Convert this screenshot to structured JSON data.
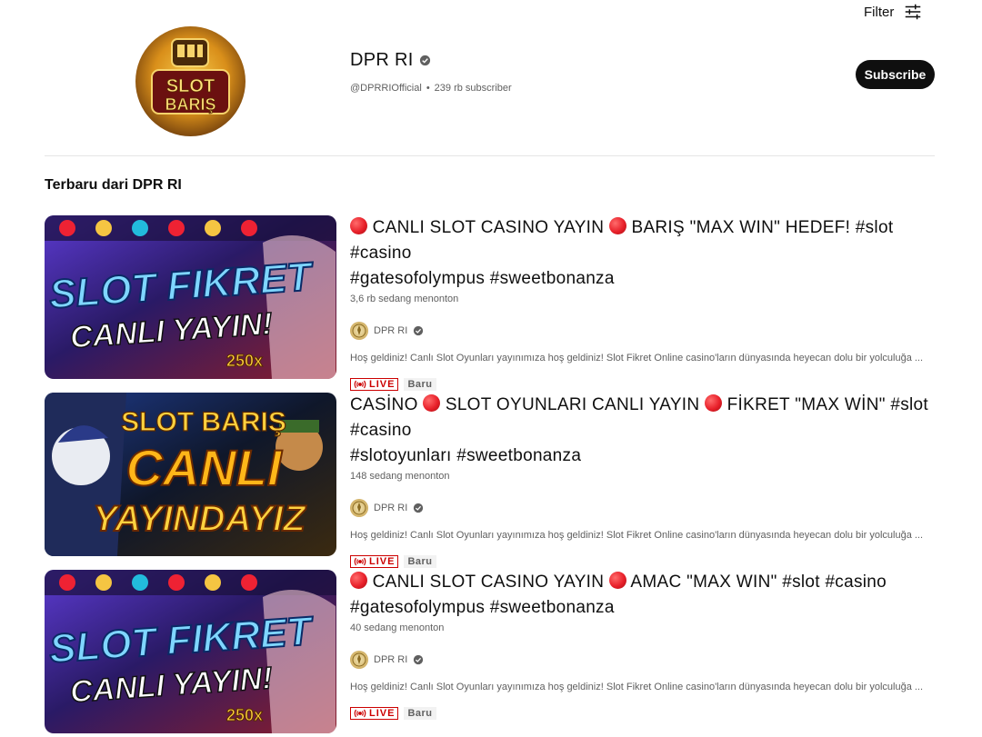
{
  "top_bar": {
    "filter_label": "Filter",
    "filter_icon": "sliders-icon"
  },
  "channel": {
    "name": "DPR RI",
    "handle": "@DPRRIOfficial",
    "separator": "•",
    "subscribers": "239 rb subscriber",
    "subscribe_label": "Subscribe",
    "avatar_text_top": "SLOT",
    "avatar_text_bottom": "BARIŞ"
  },
  "section": {
    "title": "Terbaru dari DPR RI"
  },
  "videos": [
    {
      "title_line1_a": "CANLI SLOT CASINO YAYIN",
      "title_line1_b": "BARIŞ \"MAX WIN\" HEDEF! #slot #casino",
      "title_line2": "#gatesofolympus #sweetbonanza",
      "views": "3,6 rb sedang menonton",
      "channel": "DPR RI",
      "description": "Hoş geldiniz! Canlı Slot Oyunları yayınımıza hoş geldiniz! Slot Fikret Online casino'ların dünyasında heyecan dolu bir yolculuğa ...",
      "live_label": "LIVE",
      "new_label": "Baru",
      "thumb_line1": "SLOT FIKRET",
      "thumb_line2": "CANLI YAYIN!",
      "thumb_multiplier": "250x"
    },
    {
      "title_line1_a": "CASİNO",
      "title_line1_b": "SLOT OYUNLARI CANLI YAYIN",
      "title_line1_c": "FİKRET \"MAX WİN\" #slot #casino",
      "title_line2": "#slotoyunları #sweetbonanza",
      "views": "148 sedang menonton",
      "channel": "DPR RI",
      "description": "Hoş geldiniz! Canlı Slot Oyunları yayınımıza hoş geldiniz! Slot Fikret Online casino'ların dünyasında heyecan dolu bir yolculuğa ...",
      "live_label": "LIVE",
      "new_label": "Baru",
      "thumb_line0": "SLOT BARIŞ",
      "thumb_line1": "CANLI",
      "thumb_line2": "YAYINDAYIZ"
    },
    {
      "title_line1_a": "CANLI SLOT CASINO YAYIN",
      "title_line1_b": "AMAC \"MAX WIN\" #slot #casino",
      "title_line2": "#gatesofolympus #sweetbonanza",
      "views": "40 sedang menonton",
      "channel": "DPR RI",
      "description": "Hoş geldiniz! Canlı Slot Oyunları yayınımıza hoş geldiniz! Slot Fikret Online casino'ların dünyasında heyecan dolu bir yolculuğa ...",
      "live_label": "LIVE",
      "new_label": "Baru",
      "thumb_line1": "SLOT FIKRET",
      "thumb_line2": "CANLI YAYIN!",
      "thumb_multiplier": "250x"
    }
  ],
  "colors": {
    "live": "#cc0000",
    "subscribe_bg": "#0f0f0f",
    "meta_text": "#606060"
  }
}
